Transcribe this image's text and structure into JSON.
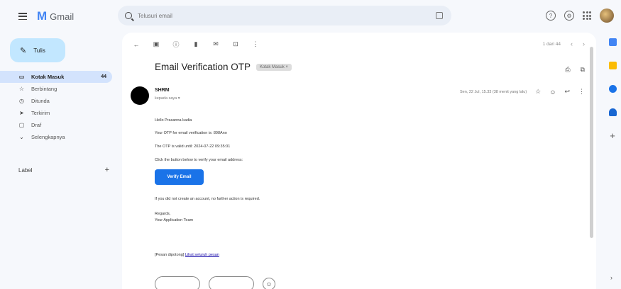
{
  "header": {
    "app_name": "Gmail",
    "search_placeholder": "Telusuri email"
  },
  "sidebar": {
    "compose_label": "Tulis",
    "items": [
      {
        "label": "Kotak Masuk",
        "count": "44",
        "icon": "inbox-icon"
      },
      {
        "label": "Berbintang",
        "icon": "star-icon"
      },
      {
        "label": "Ditunda",
        "icon": "clock-icon"
      },
      {
        "label": "Terkirim",
        "icon": "send-icon"
      },
      {
        "label": "Draf",
        "icon": "draft-icon"
      },
      {
        "label": "Selengkapnya",
        "icon": "expand-icon"
      }
    ],
    "labels_heading": "Label"
  },
  "toolbar": {
    "pager_text": "1 dari 44"
  },
  "email": {
    "subject": "Email Verification OTP",
    "label_chip": "Kotak Masuk ×",
    "sender_name": "SHRM",
    "recipient": "kepada saya ▾",
    "date": "Sen, 22 Jul, 15.33 (38 menit yang lalu)",
    "greeting": "Hello Prasanna kadia",
    "otp_line": "Your OTP for email verification is: 898Ano",
    "valid_line": "The OTP is valid until: 2024-07-22 09:35:01",
    "instruction": "Click the button below to verify your email address:",
    "button_label": "Verify Email",
    "ignore_line": "If you did not create an account, no further action is required.",
    "regards": "Regards,",
    "team": "Your Application Team",
    "footer_prefix": "[Pesan dipotong]",
    "footer_link": "Lihat seluruh pesan"
  },
  "colors": {
    "accent": "#1a73e8",
    "compose_bg": "#c2e7ff",
    "active_nav": "#d3e3fd"
  }
}
